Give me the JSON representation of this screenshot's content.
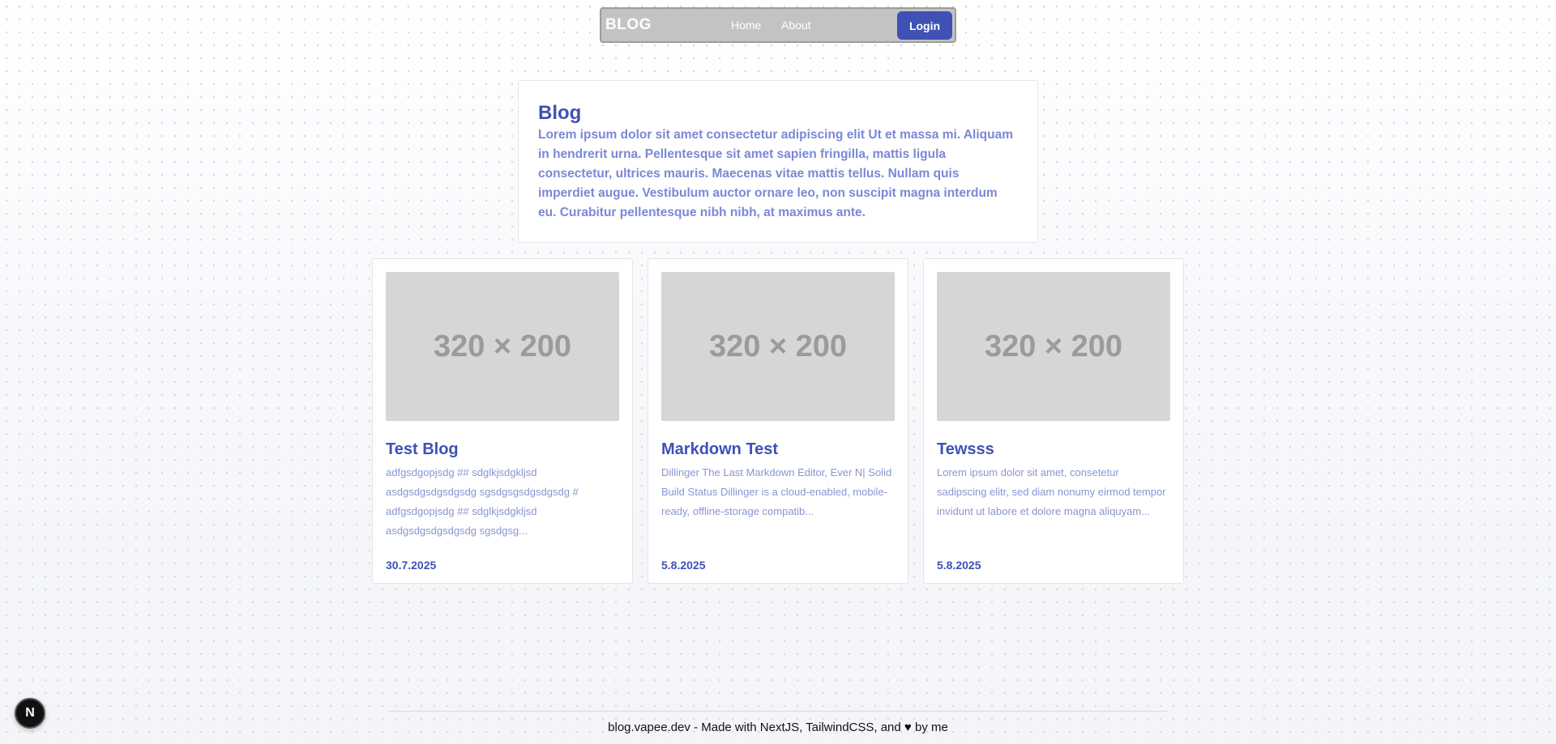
{
  "navbar": {
    "brand": "BLOG",
    "links": [
      {
        "label": "Home"
      },
      {
        "label": "About"
      }
    ],
    "login_label": "Login"
  },
  "hero": {
    "title": "Blog",
    "text": "Lorem ipsum dolor sit amet consectetur adipiscing elit Ut et massa mi. Aliquam in hendrerit urna. Pellentesque sit amet sapien fringilla, mattis ligula consectetur, ultrices mauris. Maecenas vitae mattis tellus. Nullam quis imperdiet augue. Vestibulum auctor ornare leo, non suscipit magna interdum eu. Curabitur pellentesque nibh nibh, at maximus ante."
  },
  "posts": [
    {
      "thumb": "320 × 200",
      "title": "Test Blog",
      "excerpt": "adfgsdgopjsdg ## sdglkjsdgkljsd asdgsdgsdgsdgsdg sgsdgsgsdgsdgsdg # adfgsdgopjsdg ## sdglkjsdgkljsd asdgsdgsdgsdgsdg sgsdgsg...",
      "date": "30.7.2025"
    },
    {
      "thumb": "320 × 200",
      "title": "Markdown Test",
      "excerpt": "Dillinger The Last Markdown Editor, Ever N| Solid Build Status Dillinger is a cloud-enabled, mobile-ready, offline-storage compatib...",
      "date": "5.8.2025"
    },
    {
      "thumb": "320 × 200",
      "title": "Tewsss",
      "excerpt": "Lorem ipsum dolor sit amet, consetetur sadipscing elitr, sed diam nonumy eirmod tempor invidunt ut labore et dolore magna aliquyam...",
      "date": "5.8.2025"
    }
  ],
  "footer": {
    "text_before": "blog.vapee.dev - Made with NextJS, TailwindCSS, and ",
    "heart_icon": "heart-icon",
    "text_after": " by me"
  },
  "next_badge": "N",
  "colors": {
    "accent": "#3f51b5",
    "accent_light": "#7a88d6",
    "navbar_bg": "#c3c3c3"
  }
}
